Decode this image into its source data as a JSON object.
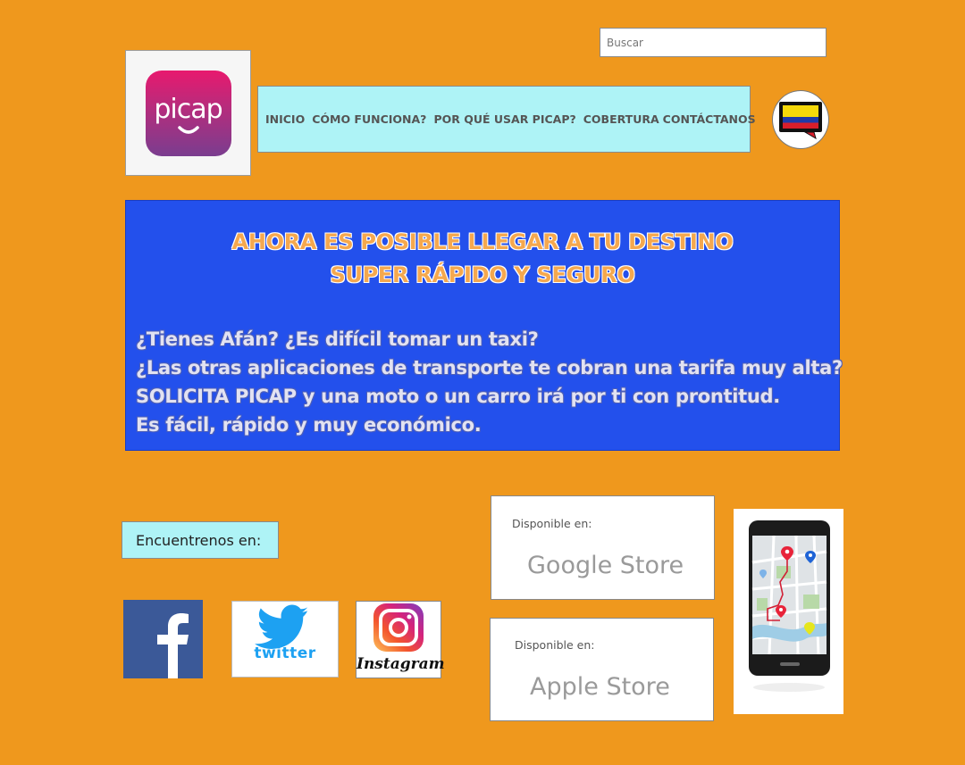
{
  "search": {
    "placeholder": "Buscar",
    "value": ""
  },
  "logo": {
    "text": "picap"
  },
  "nav": {
    "items": [
      "INICIO",
      "CÓMO FUNCIONA?",
      "POR QUÉ USAR PICAP?",
      "COBERTURA",
      "CONTÁCTANOS"
    ]
  },
  "hero": {
    "title_line1": "AHORA ES POSIBLE LLEGAR A TU DESTINO",
    "title_line2": "SUPER RÁPIDO Y SEGURO",
    "lines": [
      "¿Tienes Afán? ¿Es difícil tomar un taxi?",
      "¿Las otras aplicaciones de transporte te cobran una tarifa muy alta?",
      "SOLICITA PICAP y una moto o un carro irá por ti con prontitud.",
      "Es fácil, rápido y muy económico."
    ]
  },
  "social": {
    "label": "Encuentrenos en:",
    "twitter_text": "twitter",
    "instagram_text": "Instagram"
  },
  "stores": [
    {
      "small": "Disponible en:",
      "big": "Google Store"
    },
    {
      "small": "Disponible en:",
      "big": "Apple Store"
    }
  ],
  "colors": {
    "background": "#ef981d",
    "hero": "#2350ec",
    "nav": "#aef3f6",
    "logo_pink": "#e8196e",
    "logo_purple": "#7a3d8f",
    "facebook": "#3b5998",
    "twitter": "#1da1f2"
  },
  "icons": [
    "picap-logo",
    "colombia-flag-chat-icon",
    "facebook-icon",
    "twitter-icon",
    "instagram-icon",
    "phone-map-icon"
  ]
}
